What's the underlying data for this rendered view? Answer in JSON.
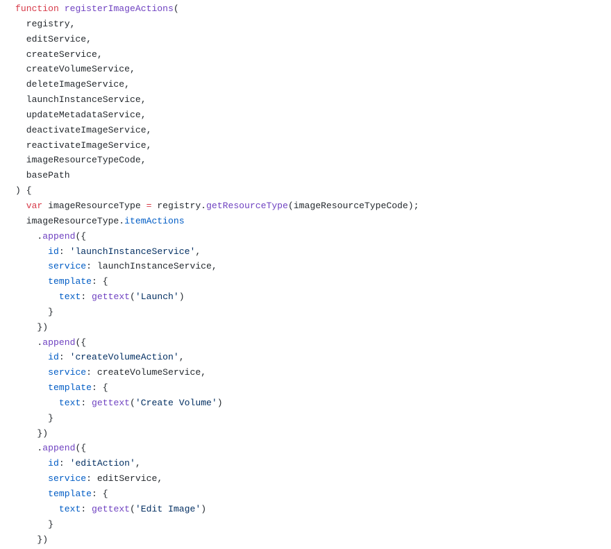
{
  "colors": {
    "background": "#ffffff",
    "plain": "#24292e",
    "keyword": "#d73a49",
    "function": "#6f42c1",
    "property": "#005cc5",
    "string": "#032f62"
  },
  "code": {
    "lines": [
      [
        {
          "t": "function",
          "c": "keyword"
        },
        {
          "t": " "
        },
        {
          "t": "registerImageActions",
          "c": "func"
        },
        {
          "t": "("
        }
      ],
      [
        {
          "t": "  registry,"
        }
      ],
      [
        {
          "t": "  editService,"
        }
      ],
      [
        {
          "t": "  createService,"
        }
      ],
      [
        {
          "t": "  createVolumeService,"
        }
      ],
      [
        {
          "t": "  deleteImageService,"
        }
      ],
      [
        {
          "t": "  launchInstanceService,"
        }
      ],
      [
        {
          "t": "  updateMetadataService,"
        }
      ],
      [
        {
          "t": "  deactivateImageService,"
        }
      ],
      [
        {
          "t": "  reactivateImageService,"
        }
      ],
      [
        {
          "t": "  imageResourceTypeCode,"
        }
      ],
      [
        {
          "t": "  basePath"
        }
      ],
      [
        {
          "t": ") {"
        }
      ],
      [
        {
          "t": "  "
        },
        {
          "t": "var",
          "c": "keyword"
        },
        {
          "t": " imageResourceType "
        },
        {
          "t": "=",
          "c": "keyword"
        },
        {
          "t": " registry."
        },
        {
          "t": "getResourceType",
          "c": "func"
        },
        {
          "t": "(imageResourceTypeCode);"
        }
      ],
      [
        {
          "t": "  imageResourceType."
        },
        {
          "t": "itemActions",
          "c": "prop"
        }
      ],
      [
        {
          "t": "    ."
        },
        {
          "t": "append",
          "c": "func"
        },
        {
          "t": "({"
        }
      ],
      [
        {
          "t": "      "
        },
        {
          "t": "id",
          "c": "prop"
        },
        {
          "t": ": "
        },
        {
          "t": "'launchInstanceService'",
          "c": "string"
        },
        {
          "t": ","
        }
      ],
      [
        {
          "t": "      "
        },
        {
          "t": "service",
          "c": "prop"
        },
        {
          "t": ": launchInstanceService,"
        }
      ],
      [
        {
          "t": "      "
        },
        {
          "t": "template",
          "c": "prop"
        },
        {
          "t": ": {"
        }
      ],
      [
        {
          "t": "        "
        },
        {
          "t": "text",
          "c": "prop"
        },
        {
          "t": ": "
        },
        {
          "t": "gettext",
          "c": "func"
        },
        {
          "t": "("
        },
        {
          "t": "'Launch'",
          "c": "string"
        },
        {
          "t": ")"
        }
      ],
      [
        {
          "t": "      }"
        }
      ],
      [
        {
          "t": "    })"
        }
      ],
      [
        {
          "t": "    ."
        },
        {
          "t": "append",
          "c": "func"
        },
        {
          "t": "({"
        }
      ],
      [
        {
          "t": "      "
        },
        {
          "t": "id",
          "c": "prop"
        },
        {
          "t": ": "
        },
        {
          "t": "'createVolumeAction'",
          "c": "string"
        },
        {
          "t": ","
        }
      ],
      [
        {
          "t": "      "
        },
        {
          "t": "service",
          "c": "prop"
        },
        {
          "t": ": createVolumeService,"
        }
      ],
      [
        {
          "t": "      "
        },
        {
          "t": "template",
          "c": "prop"
        },
        {
          "t": ": {"
        }
      ],
      [
        {
          "t": "        "
        },
        {
          "t": "text",
          "c": "prop"
        },
        {
          "t": ": "
        },
        {
          "t": "gettext",
          "c": "func"
        },
        {
          "t": "("
        },
        {
          "t": "'Create Volume'",
          "c": "string"
        },
        {
          "t": ")"
        }
      ],
      [
        {
          "t": "      }"
        }
      ],
      [
        {
          "t": "    })"
        }
      ],
      [
        {
          "t": "    ."
        },
        {
          "t": "append",
          "c": "func"
        },
        {
          "t": "({"
        }
      ],
      [
        {
          "t": "      "
        },
        {
          "t": "id",
          "c": "prop"
        },
        {
          "t": ": "
        },
        {
          "t": "'editAction'",
          "c": "string"
        },
        {
          "t": ","
        }
      ],
      [
        {
          "t": "      "
        },
        {
          "t": "service",
          "c": "prop"
        },
        {
          "t": ": editService,"
        }
      ],
      [
        {
          "t": "      "
        },
        {
          "t": "template",
          "c": "prop"
        },
        {
          "t": ": {"
        }
      ],
      [
        {
          "t": "        "
        },
        {
          "t": "text",
          "c": "prop"
        },
        {
          "t": ": "
        },
        {
          "t": "gettext",
          "c": "func"
        },
        {
          "t": "("
        },
        {
          "t": "'Edit Image'",
          "c": "string"
        },
        {
          "t": ")"
        }
      ],
      [
        {
          "t": "      }"
        }
      ],
      [
        {
          "t": "    })"
        }
      ]
    ]
  }
}
